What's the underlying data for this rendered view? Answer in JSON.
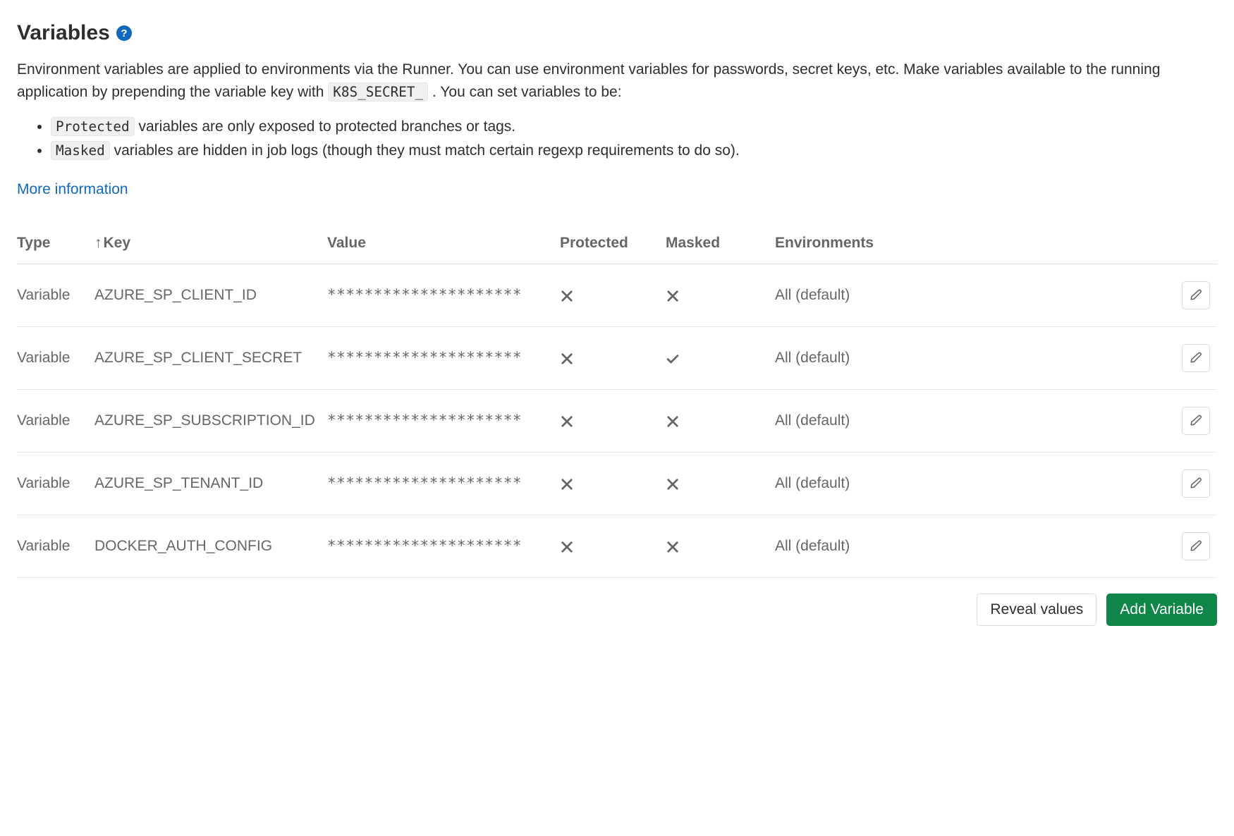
{
  "title": "Variables",
  "description": {
    "part1": "Environment variables are applied to environments via the Runner. You can use environment variables for passwords, secret keys, etc. Make variables available to the running application by prepending the variable key with ",
    "code": "K8S_SECRET_",
    "part2": ". You can set variables to be:"
  },
  "bullets": {
    "protected_code": "Protected",
    "protected_text": " variables are only exposed to protected branches or tags.",
    "masked_code": "Masked",
    "masked_text": " variables are hidden in job logs (though they must match certain regexp requirements to do so)."
  },
  "more_info_label": "More information",
  "table_headers": {
    "type": "Type",
    "key": "Key",
    "value": "Value",
    "protected": "Protected",
    "masked": "Masked",
    "environments": "Environments"
  },
  "rows": [
    {
      "type": "Variable",
      "key": "AZURE_SP_CLIENT_ID",
      "value": "*********************",
      "protected": false,
      "masked": false,
      "env": "All (default)"
    },
    {
      "type": "Variable",
      "key": "AZURE_SP_CLIENT_SECRET",
      "value": "*********************",
      "protected": false,
      "masked": true,
      "env": "All (default)"
    },
    {
      "type": "Variable",
      "key": "AZURE_SP_SUBSCRIPTION_ID",
      "value": "*********************",
      "protected": false,
      "masked": false,
      "env": "All (default)"
    },
    {
      "type": "Variable",
      "key": "AZURE_SP_TENANT_ID",
      "value": "*********************",
      "protected": false,
      "masked": false,
      "env": "All (default)"
    },
    {
      "type": "Variable",
      "key": "DOCKER_AUTH_CONFIG",
      "value": "*********************",
      "protected": false,
      "masked": false,
      "env": "All (default)"
    }
  ],
  "buttons": {
    "reveal": "Reveal values",
    "add": "Add Variable"
  }
}
